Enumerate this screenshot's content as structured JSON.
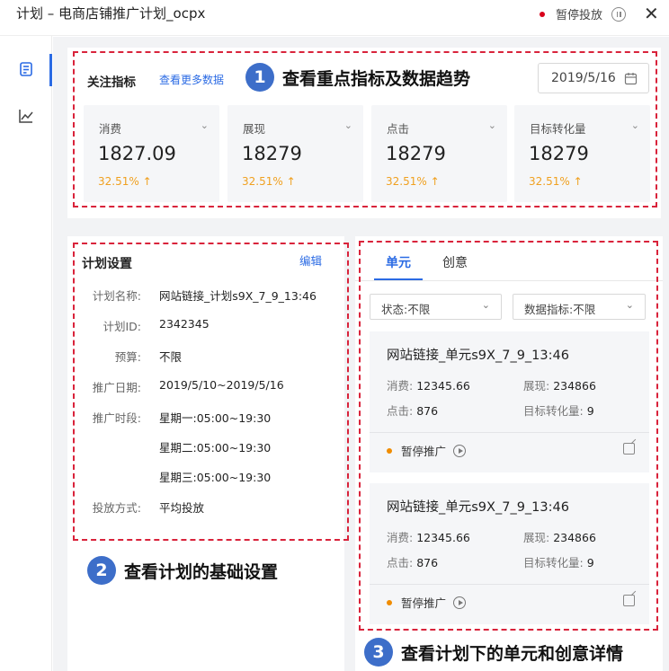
{
  "window": {
    "title": "计划 – 电商店铺推广计划_ocpx",
    "status_text": "暂停投放",
    "close_glyph": "✕",
    "status_color": "#d9001b"
  },
  "sidebar": {
    "items": [
      {
        "icon": "document-icon",
        "active": true
      },
      {
        "icon": "line-chart-icon",
        "active": false
      }
    ]
  },
  "metrics_panel": {
    "title": "关注指标",
    "more_link": "查看更多数据",
    "date": "2019/5/16",
    "cards": [
      {
        "name": "消费",
        "value": "1827.09",
        "change": "32.51%",
        "trend": "↑"
      },
      {
        "name": "展现",
        "value": "18279",
        "change": "32.51%",
        "trend": "↑"
      },
      {
        "name": "点击",
        "value": "18279",
        "change": "32.51%",
        "trend": "↑"
      },
      {
        "name": "目标转化量",
        "value": "18279",
        "change": "32.51%",
        "trend": "↑"
      }
    ],
    "chevron": "⌄"
  },
  "plan_settings": {
    "title": "计划设置",
    "edit_label": "编辑",
    "fields": [
      {
        "label": "计划名称:",
        "value": "网站链接_计划s9X_7_9_13:46"
      },
      {
        "label": "计划ID:",
        "value": "2342345"
      },
      {
        "label": "预算:",
        "value": "不限"
      },
      {
        "label": "推广日期:",
        "value": "2019/5/10~2019/5/16"
      },
      {
        "label": "推广时段:",
        "value": "星期一:05:00~19:30"
      },
      {
        "label": "",
        "value": "星期二:05:00~19:30"
      },
      {
        "label": "",
        "value": "星期三:05:00~19:30"
      },
      {
        "label": "投放方式:",
        "value": "平均投放"
      }
    ]
  },
  "units_panel": {
    "tabs": [
      "单元",
      "创意"
    ],
    "active_tab": 0,
    "filters": [
      {
        "label": "状态:不限"
      },
      {
        "label": "数据指标:不限"
      }
    ],
    "cards": [
      {
        "title": "网站链接_单元s9X_7_9_13:46",
        "spend_label": "消费:",
        "spend": "12345.66",
        "impr_label": "展现:",
        "impr": "234866",
        "click_label": "点击:",
        "click": "876",
        "conv_label": "目标转化量:",
        "conv": "9",
        "status": "暂停推广"
      },
      {
        "title": "网站链接_单元s9X_7_9_13:46",
        "spend_label": "消费:",
        "spend": "12345.66",
        "impr_label": "展现:",
        "impr": "234866",
        "click_label": "点击:",
        "click": "876",
        "conv_label": "目标转化量:",
        "conv": "9",
        "status": "暂停推广"
      }
    ]
  },
  "annotations": [
    {
      "number": "1",
      "text": "查看重点指标及数据趋势"
    },
    {
      "number": "2",
      "text": "查看计划的基础设置"
    },
    {
      "number": "3",
      "text": "查看计划下的单元和创意详情"
    }
  ],
  "colors": {
    "accent": "#2b6be4",
    "annotation_red": "#d9233b",
    "badge_blue": "#3d6ec9",
    "trend_orange": "#f0a020",
    "status_orange": "#f08c00"
  }
}
